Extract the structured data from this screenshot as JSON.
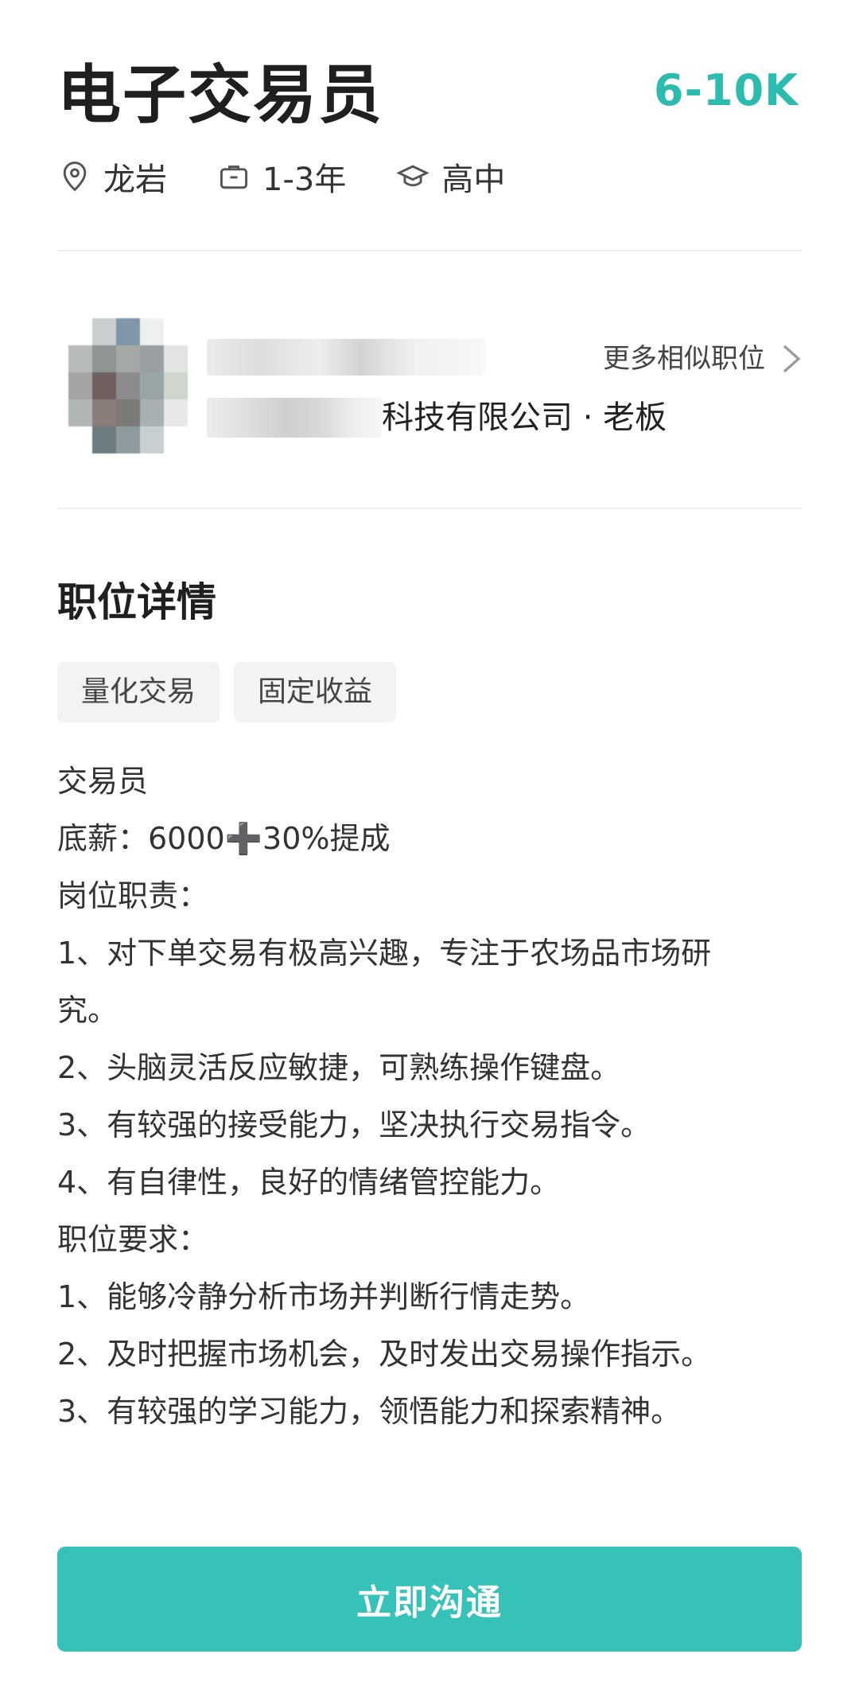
{
  "job": {
    "title": "电子交易员",
    "salary": "6-10K",
    "location": "龙岩",
    "experience": "1-3年",
    "education": "高中"
  },
  "boss": {
    "company_suffix": "科技有限公司 · 老板",
    "similar_label": "更多相似职位"
  },
  "details": {
    "section_title": "职位详情",
    "tags": [
      "量化交易",
      "固定收益"
    ],
    "lines": [
      "交易员",
      "底薪：6000➕30%提成",
      "岗位职责：",
      "1、对下单交易有极高兴趣，专注于农场品市场研",
      "究。",
      "2、头脑灵活反应敏捷，可熟练操作键盘。",
      "3、有较强的接受能力，坚决执行交易指令。",
      "4、有自律性，良好的情绪管控能力。",
      "职位要求：",
      "1、能够冷静分析市场并判断行情走势。",
      "2、及时把握市场机会，及时发出交易操作指示。",
      "3、有较强的学习能力，领悟能力和探索精神。"
    ]
  },
  "cta": {
    "label": "立即沟通"
  },
  "colors": {
    "accent": "#2bbcaf",
    "button": "#37c2b9",
    "tag_bg": "#f3f3f3",
    "divider": "#ececec"
  },
  "icons": {
    "location": "location-pin-icon",
    "experience": "briefcase-icon",
    "education": "graduation-cap-icon",
    "chevron": "chevron-right-icon"
  }
}
